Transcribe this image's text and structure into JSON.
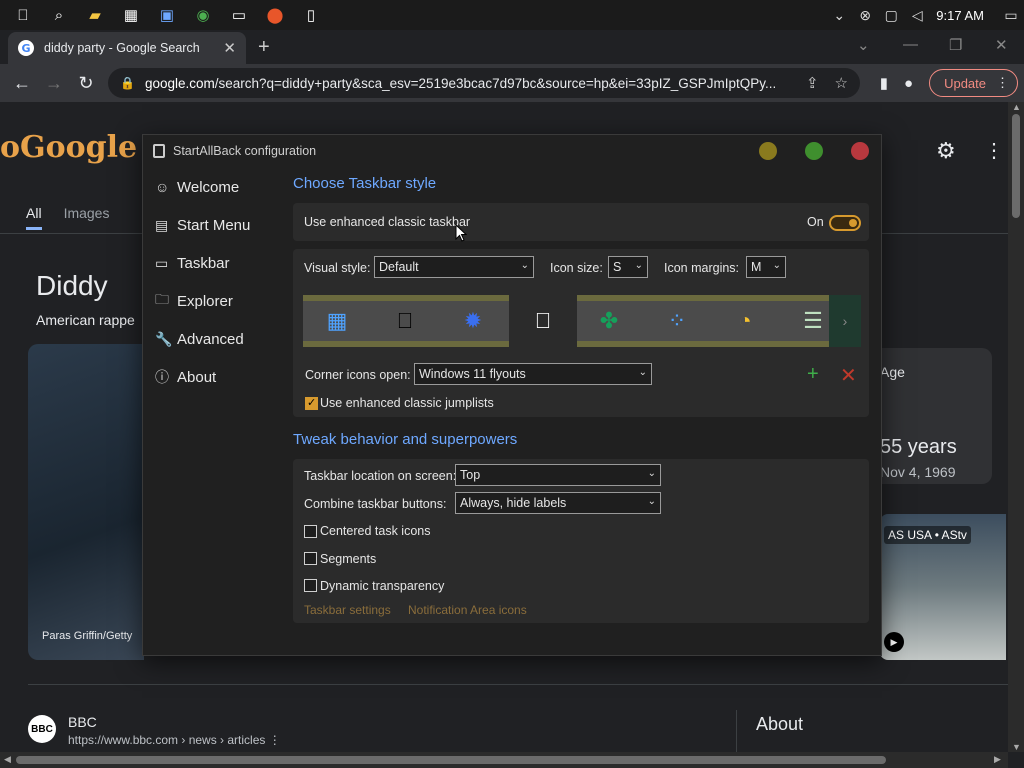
{
  "taskbar": {
    "apps": [
      "apple-icon",
      "search-icon",
      "folder-icon",
      "grid-app-icon",
      "image-app-icon",
      "chrome-icon",
      "terminal-icon",
      "maps-icon",
      "book-icon"
    ],
    "clock": "9:17 AM"
  },
  "browser": {
    "tab_title": "diddy party - Google Search",
    "url_host": "google.com",
    "url_rest": "/search?q=diddy+party&sca_esv=2519e3bcac7d97bc&source=hp&ei=33pIZ_GSPJmIptQPy...",
    "update_label": "Update"
  },
  "page": {
    "tabs": [
      "All",
      "Images"
    ],
    "title": "Diddy",
    "subtitle": "American rappe",
    "photo_credit": "Paras Griffin/Getty",
    "age_label": "Age",
    "age_value": "55 years",
    "age_date": "Nov 4, 1969",
    "video_badge": "AS USA • AStv",
    "result_name": "BBC",
    "result_url": "https://www.bbc.com › news › articles",
    "about": "About",
    "bbc_logo": "BBC"
  },
  "dialog": {
    "title": "StartAllBack configuration",
    "sidebar": [
      {
        "icon": "☺",
        "label": "Welcome"
      },
      {
        "icon": "▤",
        "label": "Start Menu"
      },
      {
        "icon": "▭",
        "label": "Taskbar"
      },
      {
        "icon": "🗀",
        "label": "Explorer"
      },
      {
        "icon": "🔧",
        "label": "Advanced"
      },
      {
        "icon": "ⓘ",
        "label": "About"
      }
    ],
    "section1": "Choose Taskbar style",
    "enhanced_label": "Use enhanced classic taskbar",
    "toggle_state": "On",
    "visual_style_label": "Visual style:",
    "visual_style_value": "Default",
    "icon_size_label": "Icon size:",
    "icon_size_value": "S",
    "icon_margins_label": "Icon margins:",
    "icon_margins_value": "M",
    "corner_label": "Corner icons open:",
    "corner_value": "Windows 11 flyouts",
    "jumplists_label": "Use enhanced classic jumplists",
    "section2": "Tweak behavior and superpowers",
    "location_label": "Taskbar location on screen:",
    "location_value": "Top",
    "combine_label": "Combine taskbar buttons:",
    "combine_value": "Always, hide labels",
    "centered_label": "Centered task icons",
    "segments_label": "Segments",
    "dynamic_label": "Dynamic transparency",
    "link1": "Taskbar settings",
    "link2": "Notification Area icons"
  },
  "colors": {
    "accent_blue": "#6ea8ff",
    "toggle_orange": "#d79a2e",
    "dot_yellow": "#8a7a1e",
    "dot_green": "#3f8f2e",
    "dot_red": "#b8383e"
  }
}
